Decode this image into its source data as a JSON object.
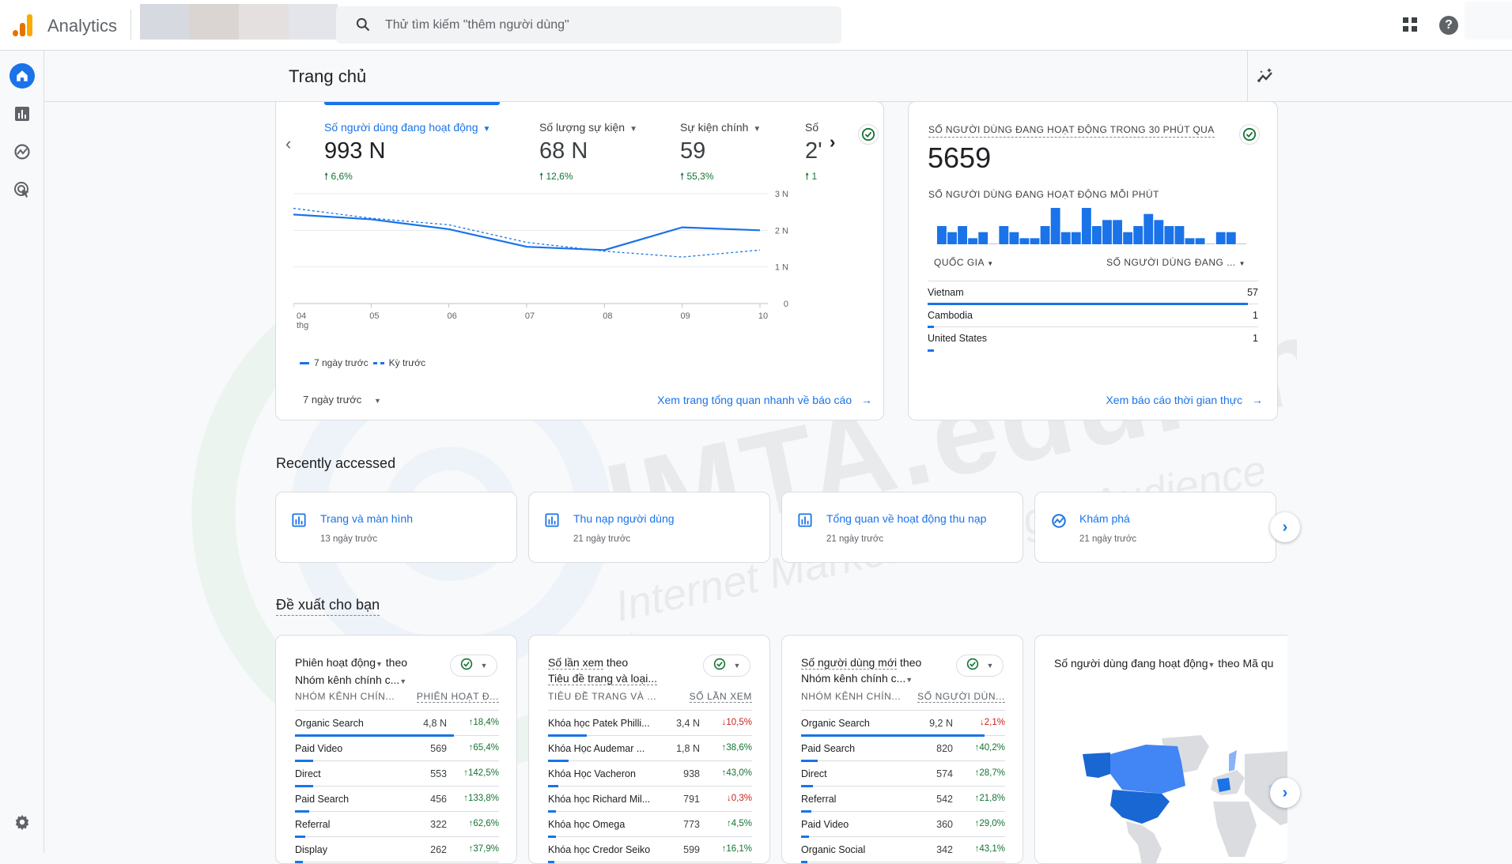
{
  "app": {
    "name": "Analytics",
    "title": "Trang chủ"
  },
  "search": {
    "placeholder": "Thử tìm kiếm \"thêm người dùng\""
  },
  "icons": {
    "logo": "analytics-logo",
    "search": "search-icon",
    "apps": "apps-grid-icon",
    "help": "help-icon",
    "sidebar": [
      "home-icon",
      "reports-icon",
      "explore-icon",
      "advertising-icon",
      "settings-icon"
    ],
    "insights": "insights-sparkle-icon"
  },
  "help_glyph": "?",
  "colors": {
    "accent": "#1a73e8",
    "positive": "#137333",
    "negative": "#c5221f",
    "logo_orange": "#e37400",
    "logo_yellow": "#f9ab00"
  },
  "overview": {
    "metrics": [
      {
        "label": "Số người dùng đang hoạt động",
        "value": "993 N",
        "delta": "6,6%",
        "trend": "up",
        "active": true
      },
      {
        "label": "Số lượng sự kiện",
        "value": "68 N",
        "delta": "12,6%",
        "trend": "up",
        "active": false
      },
      {
        "label": "Sự kiện chính",
        "value": "59",
        "delta": "55,3%",
        "trend": "up",
        "active": false
      },
      {
        "label": "Số",
        "value": "2'",
        "delta": "1",
        "trend": "up",
        "active": false
      }
    ],
    "prev_glyph": "‹",
    "next_glyph": "›",
    "legend": {
      "current": "7 ngày trước",
      "previous": "Kỳ trước"
    },
    "range_select": "7 ngày trước",
    "link": "Xem trang tổng quan nhanh về báo cáo"
  },
  "chart_data": {
    "type": "line",
    "title": "Số người dùng đang hoạt động",
    "x": [
      "04",
      "05",
      "06",
      "07",
      "08",
      "09",
      "10"
    ],
    "x_sublabel_first": "thg",
    "series": [
      {
        "name": "7 ngày trước",
        "style": "solid",
        "values": [
          2430,
          2300,
          2030,
          1550,
          1460,
          2080,
          2000
        ]
      },
      {
        "name": "Kỳ trước",
        "style": "dashed",
        "values": [
          2600,
          2330,
          2150,
          1670,
          1430,
          1270,
          1460
        ]
      }
    ],
    "yticks": [
      {
        "value": 0,
        "label": "0"
      },
      {
        "value": 1000,
        "label": "1 N"
      },
      {
        "value": 2000,
        "label": "2 N"
      },
      {
        "value": 3000,
        "label": "3 N"
      }
    ],
    "ylim": [
      0,
      3000
    ],
    "xlabel": "",
    "ylabel": "",
    "grid": true,
    "legend": "bottom-left"
  },
  "realtime": {
    "title": "SỐ NGƯỜI DÙNG ĐANG HOẠT ĐỘNG TRONG 30 PHÚT QUA",
    "value": "5659",
    "subtitle": "SỐ NGƯỜI DÙNG ĐANG HOẠT ĐỘNG MỖI PHÚT",
    "per_minute": [
      3,
      2,
      3,
      1,
      2,
      0,
      3,
      2,
      1,
      1,
      3,
      6,
      2,
      2,
      6,
      3,
      4,
      4,
      2,
      3,
      5,
      4,
      3,
      3,
      1,
      1,
      0,
      2,
      2,
      0
    ],
    "col1": "QUỐC GIA",
    "col2": "SỐ NGƯỜI DÙNG ĐANG ...",
    "rows": [
      {
        "country": "Vietnam",
        "users": "57",
        "share": 0.97
      },
      {
        "country": "Cambodia",
        "users": "1",
        "share": 0.02
      },
      {
        "country": "United States",
        "users": "1",
        "share": 0.02
      }
    ],
    "link": "Xem báo cáo thời gian thực"
  },
  "recent": {
    "title": "Recently accessed",
    "items": [
      {
        "title": "Trang và màn hình",
        "time": "13 ngày trước",
        "icon": "report-icon"
      },
      {
        "title": "Thu nạp người dùng",
        "time": "21 ngày trước",
        "icon": "report-icon"
      },
      {
        "title": "Tổng quan về hoạt động thu nạp",
        "time": "21 ngày trước",
        "icon": "report-icon"
      },
      {
        "title": "Khám phá",
        "time": "21 ngày trước",
        "icon": "explore-icon"
      }
    ],
    "next_glyph": "›"
  },
  "suggestions": {
    "title": "Đề xuất cho bạn",
    "cards": [
      {
        "head1": "Phiên hoạt động",
        "head1_caret": true,
        "head_theo": " theo",
        "head2": "Nhóm kênh chính c...",
        "head2_caret": true,
        "col1": "NHÓM KÊNH CHÍN...",
        "col2": "PHIÊN HOẠT Đ...",
        "rows": [
          {
            "name": "Organic Search",
            "value": "4,8 N",
            "delta": "18,4%",
            "trend": "up",
            "share": 0.78
          },
          {
            "name": "Paid Video",
            "value": "569",
            "delta": "65,4%",
            "trend": "up",
            "share": 0.09
          },
          {
            "name": "Direct",
            "value": "553",
            "delta": "142,5%",
            "trend": "up",
            "share": 0.09
          },
          {
            "name": "Paid Search",
            "value": "456",
            "delta": "133,8%",
            "trend": "up",
            "share": 0.07
          },
          {
            "name": "Referral",
            "value": "322",
            "delta": "62,6%",
            "trend": "up",
            "share": 0.05
          },
          {
            "name": "Display",
            "value": "262",
            "delta": "37,9%",
            "trend": "up",
            "share": 0.04
          }
        ]
      },
      {
        "head1": "Số lần xem",
        "head1_caret": false,
        "head_theo": " theo",
        "head2": "Tiêu đề trang và loại...",
        "head2_caret": false,
        "col1": "TIÊU ĐỀ TRANG VÀ ...",
        "col2": "SỐ LẦN XEM",
        "rows": [
          {
            "name": "Khóa học Patek Philli...",
            "value": "3,4 N",
            "delta": "10,5%",
            "trend": "down",
            "share": 0.19
          },
          {
            "name": "Khóa Học Audemar ...",
            "value": "1,8 N",
            "delta": "38,6%",
            "trend": "up",
            "share": 0.1
          },
          {
            "name": "Khóa Học Vacheron",
            "value": "938",
            "delta": "43,0%",
            "trend": "up",
            "share": 0.05
          },
          {
            "name": "Khóa học Richard Mil...",
            "value": "791",
            "delta": "0,3%",
            "trend": "down",
            "share": 0.04
          },
          {
            "name": "Khóa học Omega",
            "value": "773",
            "delta": "4,5%",
            "trend": "up",
            "share": 0.04
          },
          {
            "name": "Khóa học Credor Seiko",
            "value": "599",
            "delta": "16,1%",
            "trend": "up",
            "share": 0.03
          }
        ]
      },
      {
        "head1": "Số người dùng mới",
        "head1_caret": false,
        "head_theo": " theo",
        "head2": "Nhóm kênh chính c...",
        "head2_caret": true,
        "col1": "NHÓM KÊNH CHÍN...",
        "col2": "SỐ NGƯỜI DÙN...",
        "rows": [
          {
            "name": "Organic Search",
            "value": "9,2 N",
            "delta": "2,1%",
            "trend": "down",
            "share": 0.9
          },
          {
            "name": "Paid Search",
            "value": "820",
            "delta": "40,2%",
            "trend": "up",
            "share": 0.08
          },
          {
            "name": "Direct",
            "value": "574",
            "delta": "28,7%",
            "trend": "up",
            "share": 0.06
          },
          {
            "name": "Referral",
            "value": "542",
            "delta": "21,8%",
            "trend": "up",
            "share": 0.05
          },
          {
            "name": "Paid Video",
            "value": "360",
            "delta": "29,0%",
            "trend": "up",
            "share": 0.04
          },
          {
            "name": "Organic Social",
            "value": "342",
            "delta": "43,1%",
            "trend": "up",
            "share": 0.03
          }
        ]
      }
    ],
    "map_card": {
      "title_metric": "Số người dùng đang hoạt động",
      "title_rest": " theo Mã qu"
    },
    "next_glyph": "›"
  },
  "watermark": {
    "main": "IMTA.edu.vn",
    "sub": "Internet Marketing Target Audience"
  }
}
